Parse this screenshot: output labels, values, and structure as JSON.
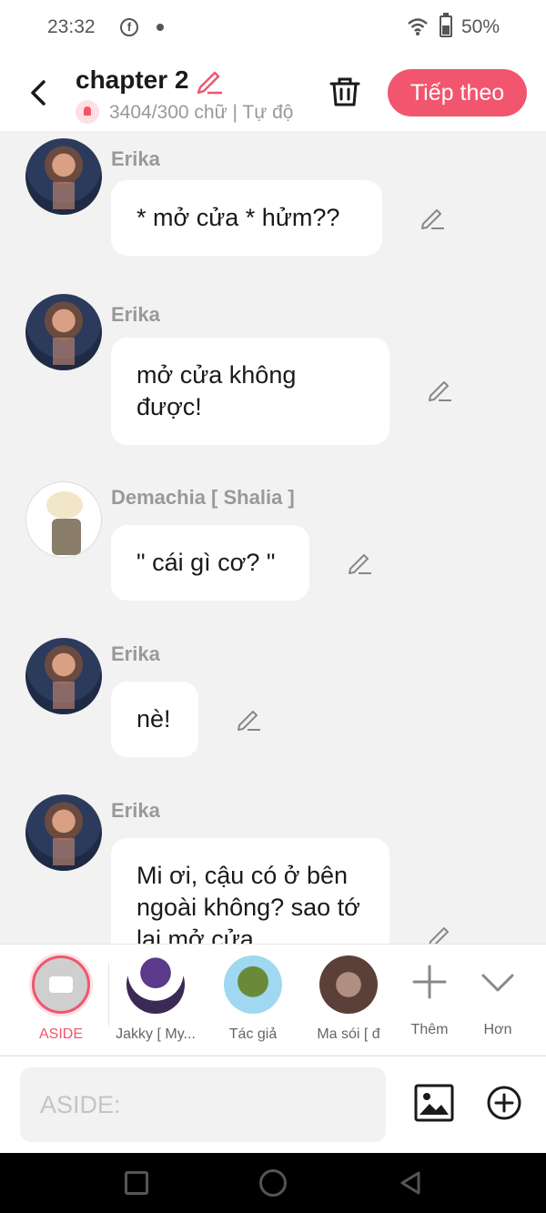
{
  "status_bar": {
    "time": "23:32",
    "battery": "50%",
    "fb_glyph": "f"
  },
  "header": {
    "title": "chapter 2",
    "subtitle": "3404/300 chữ | Tự độ",
    "next_button": "Tiếp theo"
  },
  "messages": [
    {
      "name": "Erika",
      "text": "* mở cửa * hửm??",
      "avatar": "erika"
    },
    {
      "name": "Erika",
      "text": "mở cửa không được!",
      "avatar": "erika"
    },
    {
      "name": "Demachia [ Shalia ]",
      "text": "\" cái gì cơ? \"",
      "avatar": "demachia"
    },
    {
      "name": "Erika",
      "text": "nè!",
      "avatar": "erika"
    },
    {
      "name": "Erika",
      "text": "Mi ơi, cậu có ở bên ngoài không? sao tớ lại mở cửa",
      "avatar": "erika"
    }
  ],
  "characters": [
    {
      "label": "ASIDE",
      "selected": true
    },
    {
      "label": "Jakky [ My..."
    },
    {
      "label": "Tác giả"
    },
    {
      "label": "Ma sói [ đ"
    },
    {
      "label": "Thêm",
      "icon": "plus-icon"
    },
    {
      "label": "Hơn",
      "icon": "chevron-down-icon"
    }
  ],
  "input": {
    "placeholder": "ASIDE:"
  },
  "colors": {
    "accent": "#f2556e",
    "background": "#f2f2f2",
    "bubble": "#ffffff"
  }
}
